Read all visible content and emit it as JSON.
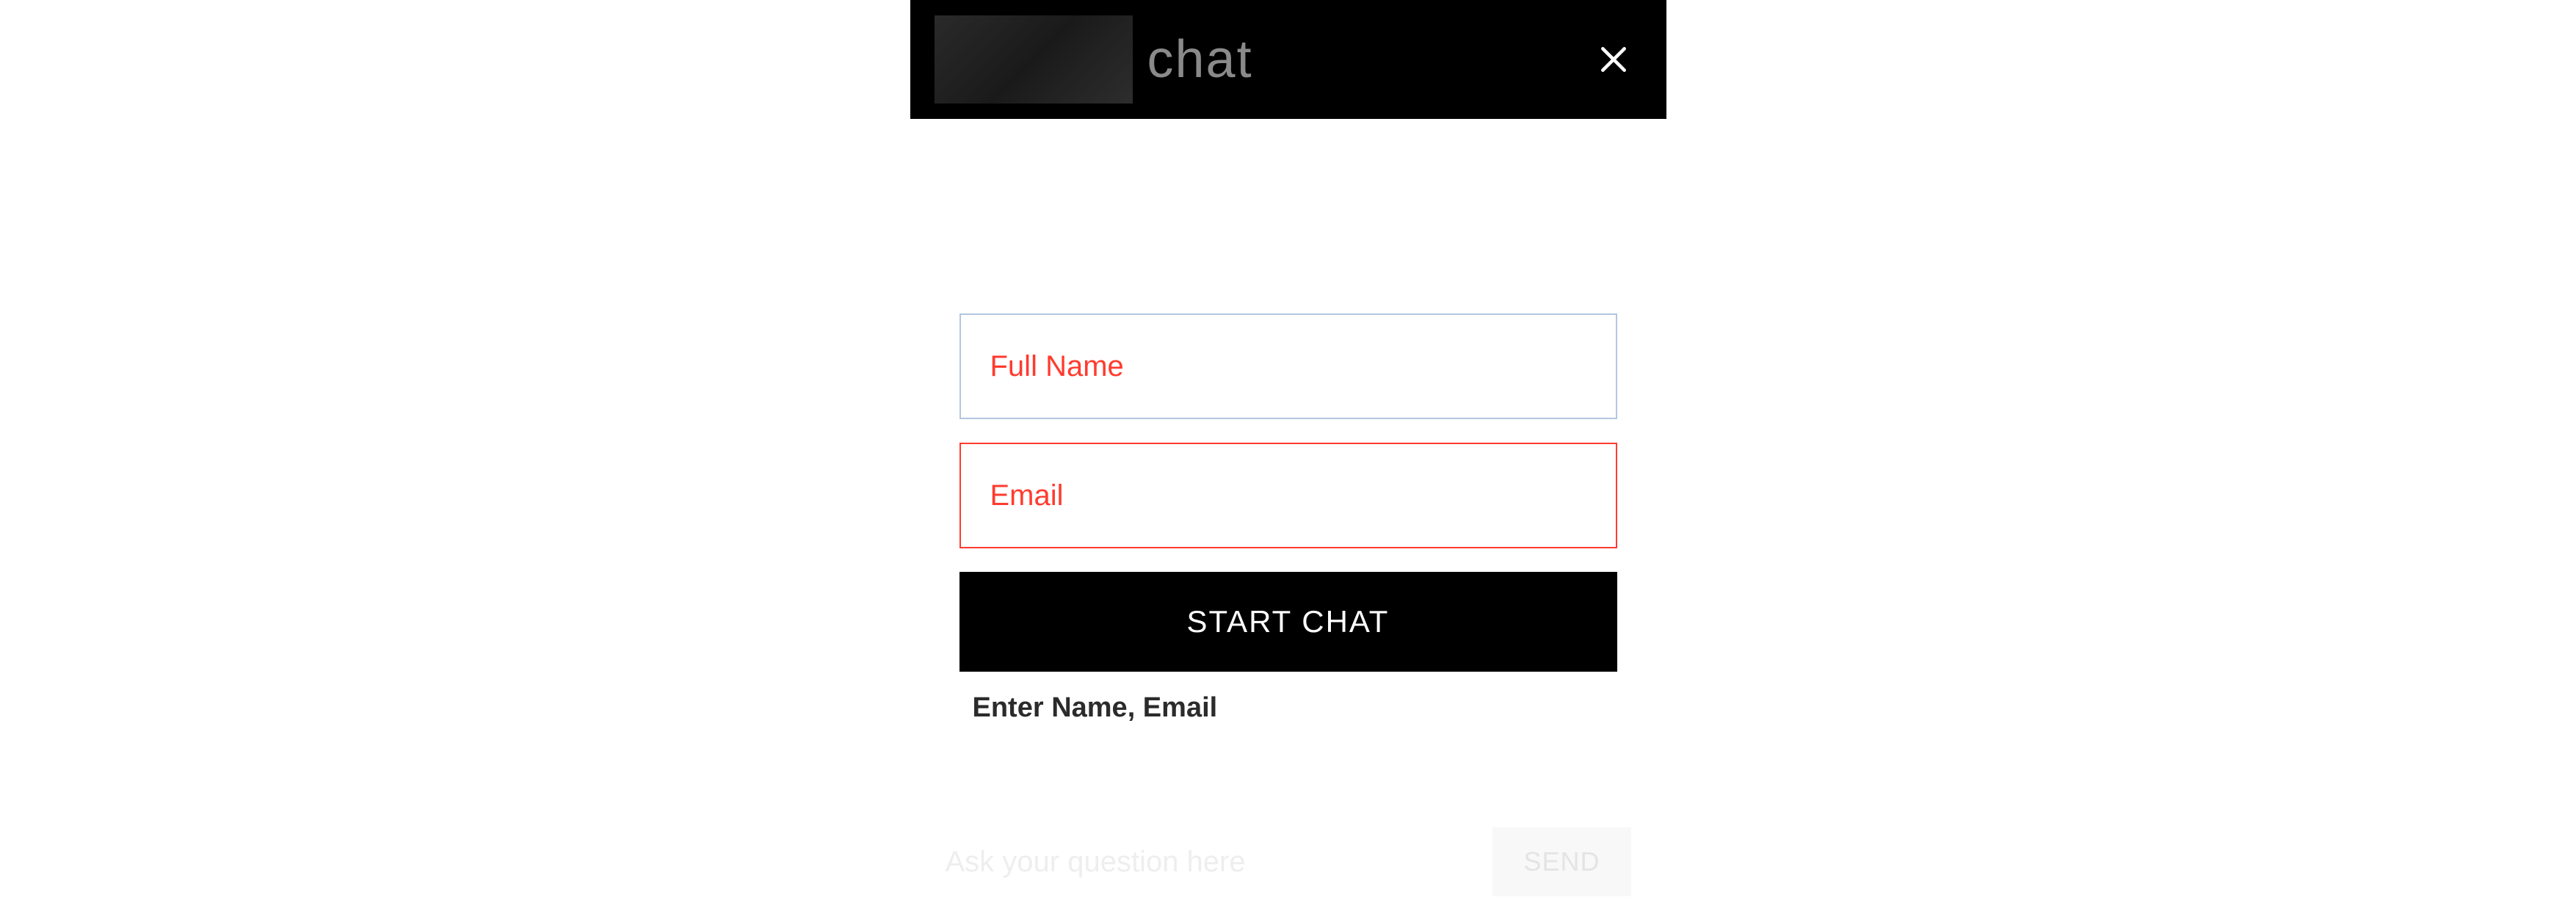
{
  "header": {
    "title": "chat"
  },
  "form": {
    "fullName": {
      "placeholder": "Full Name",
      "value": ""
    },
    "email": {
      "placeholder": "Email",
      "value": ""
    },
    "startButton": "START CHAT",
    "validationMessage": "Enter Name, Email"
  },
  "footer": {
    "question": {
      "placeholder": "Ask your question here",
      "value": ""
    },
    "sendButton": "SEND"
  }
}
